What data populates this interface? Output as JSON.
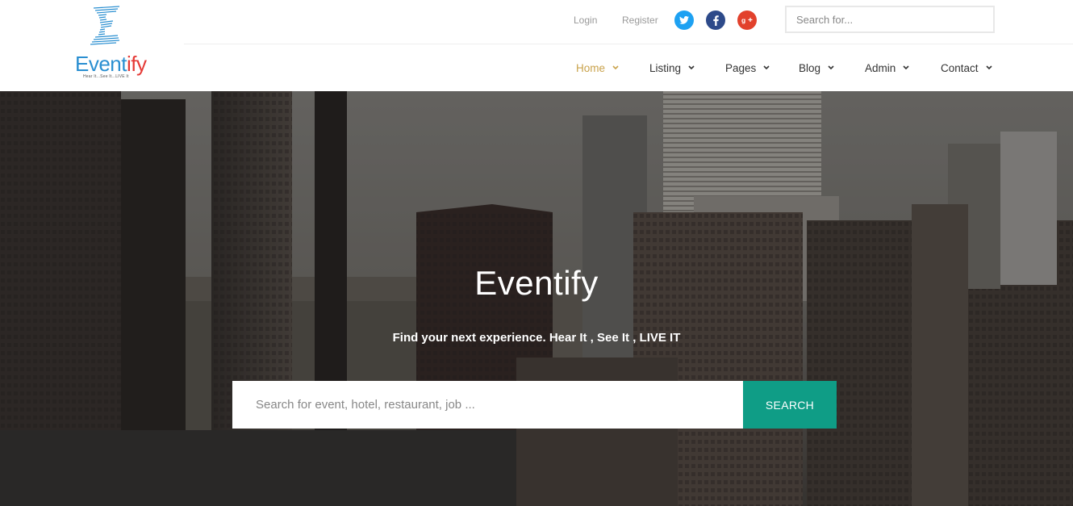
{
  "brand": {
    "name_part1": "Event",
    "name_part2": "ify",
    "tagline": "Hear It...See It...LIVE It"
  },
  "topbar": {
    "login": "Login",
    "register": "Register",
    "social": [
      "twitter-icon",
      "facebook-icon",
      "google-plus-icon"
    ],
    "search_placeholder": "Search for..."
  },
  "nav": {
    "items": [
      {
        "label": "Home",
        "active": true
      },
      {
        "label": "Listing"
      },
      {
        "label": "Pages"
      },
      {
        "label": "Blog"
      },
      {
        "label": "Admin"
      },
      {
        "label": "Contact"
      }
    ]
  },
  "hero": {
    "title": "Eventify",
    "subtitle": "Find your next experience. Hear It , See It , LIVE IT",
    "search_placeholder": "Search for event, hotel, restaurant, job ...",
    "button": "SEARCH"
  },
  "colors": {
    "accent": "#c9a24b",
    "button": "#0f9d86",
    "twitter": "#1da1f2",
    "facebook": "#2d4a8a",
    "google_plus": "#e2412c"
  }
}
